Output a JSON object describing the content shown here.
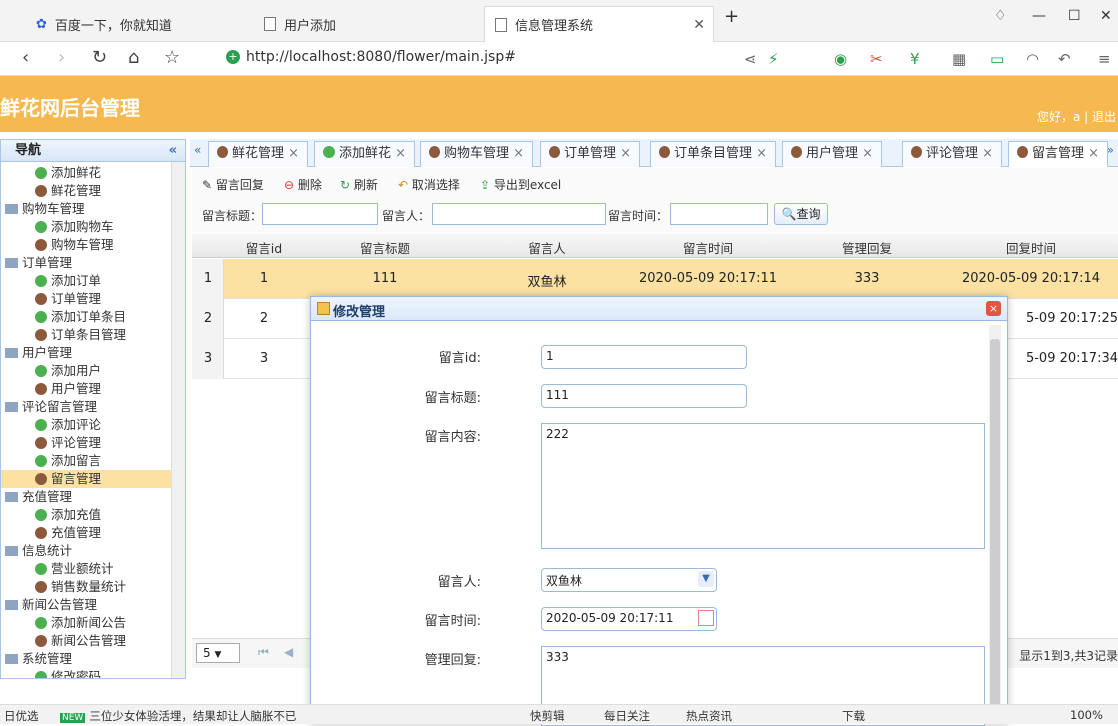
{
  "browser": {
    "tabs": [
      {
        "title": "百度一下，你就知道",
        "active": false
      },
      {
        "title": "用户添加",
        "active": false
      },
      {
        "title": "信息管理系统",
        "active": true
      }
    ],
    "new_tab": "+",
    "url": "http://localhost:8080/flower/main.jsp#"
  },
  "app": {
    "title": "鲜花网后台管理",
    "user_text": "您好，a | 退出"
  },
  "sidebar": {
    "header": "导航",
    "items": [
      {
        "type": "leaf",
        "label": "添加鲜花",
        "icon": "add-icon"
      },
      {
        "type": "leaf",
        "label": "鲜花管理",
        "icon": "user-icon"
      },
      {
        "type": "folder",
        "label": "购物车管理"
      },
      {
        "type": "leaf",
        "label": "添加购物车",
        "icon": "add-icon"
      },
      {
        "type": "leaf",
        "label": "购物车管理",
        "icon": "user-icon"
      },
      {
        "type": "folder",
        "label": "订单管理"
      },
      {
        "type": "leaf",
        "label": "添加订单",
        "icon": "add-icon"
      },
      {
        "type": "leaf",
        "label": "订单管理",
        "icon": "user-icon"
      },
      {
        "type": "leaf",
        "label": "添加订单条目",
        "icon": "add-icon"
      },
      {
        "type": "leaf",
        "label": "订单条目管理",
        "icon": "user-icon"
      },
      {
        "type": "folder",
        "label": "用户管理"
      },
      {
        "type": "leaf",
        "label": "添加用户",
        "icon": "add-icon"
      },
      {
        "type": "leaf",
        "label": "用户管理",
        "icon": "user-icon"
      },
      {
        "type": "folder",
        "label": "评论留言管理"
      },
      {
        "type": "leaf",
        "label": "添加评论",
        "icon": "add-icon"
      },
      {
        "type": "leaf",
        "label": "评论管理",
        "icon": "user-icon"
      },
      {
        "type": "leaf",
        "label": "添加留言",
        "icon": "add-icon"
      },
      {
        "type": "leaf",
        "label": "留言管理",
        "icon": "user-icon",
        "selected": true
      },
      {
        "type": "folder",
        "label": "充值管理"
      },
      {
        "type": "leaf",
        "label": "添加充值",
        "icon": "add-icon"
      },
      {
        "type": "leaf",
        "label": "充值管理",
        "icon": "user-icon"
      },
      {
        "type": "folder",
        "label": "信息统计"
      },
      {
        "type": "leaf",
        "label": "营业额统计",
        "icon": "add-icon"
      },
      {
        "type": "leaf",
        "label": "销售数量统计",
        "icon": "user-icon"
      },
      {
        "type": "folder",
        "label": "新闻公告管理"
      },
      {
        "type": "leaf",
        "label": "添加新闻公告",
        "icon": "add-icon"
      },
      {
        "type": "leaf",
        "label": "新闻公告管理",
        "icon": "user-icon"
      },
      {
        "type": "folder",
        "label": "系统管理"
      },
      {
        "type": "leaf",
        "label": "修改密码",
        "icon": "add-icon"
      }
    ]
  },
  "main_tabs": [
    {
      "label": "鲜花管理",
      "icon": "user"
    },
    {
      "label": "添加鲜花",
      "icon": "add"
    },
    {
      "label": "购物车管理",
      "icon": "user"
    },
    {
      "label": "订单管理",
      "icon": "user"
    },
    {
      "label": "订单条目管理",
      "icon": "user"
    },
    {
      "label": "用户管理",
      "icon": "user"
    },
    {
      "label": "评论管理",
      "icon": "user"
    },
    {
      "label": "留言管理",
      "icon": "user",
      "active": true
    }
  ],
  "toolbar": {
    "reply": "留言回复",
    "delete": "删除",
    "refresh": "刷新",
    "cancel_select": "取消选择",
    "export": "导出到excel"
  },
  "search": {
    "title_label": "留言标题：",
    "author_label": "留言人：",
    "time_label": "留言时间：",
    "query_button": "查询"
  },
  "grid": {
    "columns": [
      "留言id",
      "留言标题",
      "留言人",
      "留言时间",
      "管理回复",
      "回复时间"
    ],
    "rows": [
      {
        "rownum": "1",
        "id": "1",
        "title": "111",
        "author": "双鱼林",
        "time": "2020-05-09 20:17:11",
        "reply": "333",
        "reply_time": "2020-05-09 20:17:14",
        "selected": true
      },
      {
        "rownum": "2",
        "id": "2",
        "title": "",
        "author": "",
        "time": "",
        "reply": "",
        "reply_time": "5-09 20:17:25"
      },
      {
        "rownum": "3",
        "id": "3",
        "title": "",
        "author": "",
        "time": "",
        "reply": "",
        "reply_time": "5-09 20:17:34"
      }
    ],
    "page_size": "5",
    "page_info": "显示1到3,共3记录"
  },
  "modal": {
    "title": "修改管理",
    "close": "×",
    "fields": {
      "id_label": "留言id:",
      "id_value": "1",
      "title_label": "留言标题:",
      "title_value": "111",
      "content_label": "留言内容:",
      "content_value": "222",
      "author_label": "留言人:",
      "author_value": "双鱼林",
      "time_label": "留言时间:",
      "time_value": "2020-05-09 20:17:11",
      "reply_label": "管理回复:",
      "reply_value": "333"
    }
  },
  "statusbar": {
    "left": "日优选",
    "news": "三位少女体验活埋，结果却让人脑胀不已",
    "items": [
      "快剪辑",
      "每日关注",
      "热点资讯",
      "下载",
      "100%"
    ]
  },
  "colors": {
    "header_bg": "#f5b94f",
    "selection": "#fbe2a2",
    "border_blue": "#a9c6e8"
  }
}
